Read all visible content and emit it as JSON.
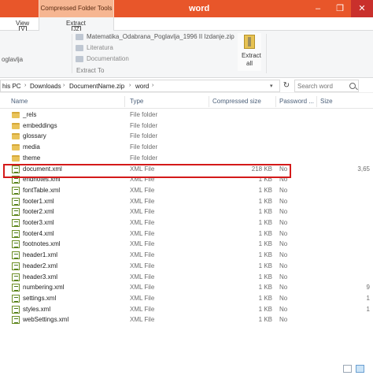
{
  "window": {
    "title": "word",
    "context_tab": "Compressed Folder Tools",
    "minimize": "–",
    "restore": "❐",
    "close": "✕"
  },
  "tabs": {
    "view": "View",
    "view_key": "V",
    "extract": "Extract",
    "extract_key": "JZ"
  },
  "ribbon": {
    "dest_partial": "oglavlja",
    "destinations": [
      "Matematika_Odabrana_Poglavlja_1996 II Izdanje.zip",
      "Literatura",
      "Documentation"
    ],
    "extract_all": "Extract\nall",
    "extract_all_line1": "Extract",
    "extract_all_line2": "all",
    "group_label": "Extract To"
  },
  "address": {
    "crumbs": [
      "his PC",
      "Downloads",
      "DocumentName.zip",
      "word"
    ],
    "search_placeholder": "Search word"
  },
  "columns": {
    "name": "Name",
    "type": "Type",
    "compressed": "Compressed size",
    "password": "Password ...",
    "size": "Size"
  },
  "rows": [
    {
      "name": "_rels",
      "kind": "folder",
      "type": "File folder",
      "compressed": "",
      "password": "",
      "size": ""
    },
    {
      "name": "embeddings",
      "kind": "folder",
      "type": "File folder",
      "compressed": "",
      "password": "",
      "size": ""
    },
    {
      "name": "glossary",
      "kind": "folder",
      "type": "File folder",
      "compressed": "",
      "password": "",
      "size": ""
    },
    {
      "name": "media",
      "kind": "folder",
      "type": "File folder",
      "compressed": "",
      "password": "",
      "size": ""
    },
    {
      "name": "theme",
      "kind": "folder",
      "type": "File folder",
      "compressed": "",
      "password": "",
      "size": ""
    },
    {
      "name": "document.xml",
      "kind": "xml",
      "type": "XML File",
      "compressed": "218 KB",
      "password": "No",
      "size": "3,65"
    },
    {
      "name": "endnotes.xml",
      "kind": "xml",
      "type": "XML File",
      "compressed": "1 KB",
      "password": "No",
      "size": ""
    },
    {
      "name": "fontTable.xml",
      "kind": "xml",
      "type": "XML File",
      "compressed": "1 KB",
      "password": "No",
      "size": ""
    },
    {
      "name": "footer1.xml",
      "kind": "xml",
      "type": "XML File",
      "compressed": "1 KB",
      "password": "No",
      "size": ""
    },
    {
      "name": "footer2.xml",
      "kind": "xml",
      "type": "XML File",
      "compressed": "1 KB",
      "password": "No",
      "size": ""
    },
    {
      "name": "footer3.xml",
      "kind": "xml",
      "type": "XML File",
      "compressed": "1 KB",
      "password": "No",
      "size": ""
    },
    {
      "name": "footer4.xml",
      "kind": "xml",
      "type": "XML File",
      "compressed": "1 KB",
      "password": "No",
      "size": ""
    },
    {
      "name": "footnotes.xml",
      "kind": "xml",
      "type": "XML File",
      "compressed": "1 KB",
      "password": "No",
      "size": ""
    },
    {
      "name": "header1.xml",
      "kind": "xml",
      "type": "XML File",
      "compressed": "1 KB",
      "password": "No",
      "size": ""
    },
    {
      "name": "header2.xml",
      "kind": "xml",
      "type": "XML File",
      "compressed": "1 KB",
      "password": "No",
      "size": ""
    },
    {
      "name": "header3.xml",
      "kind": "xml",
      "type": "XML File",
      "compressed": "1 KB",
      "password": "No",
      "size": ""
    },
    {
      "name": "numbering.xml",
      "kind": "xml",
      "type": "XML File",
      "compressed": "1 KB",
      "password": "No",
      "size": "9"
    },
    {
      "name": "settings.xml",
      "kind": "xml",
      "type": "XML File",
      "compressed": "1 KB",
      "password": "No",
      "size": "1"
    },
    {
      "name": "styles.xml",
      "kind": "xml",
      "type": "XML File",
      "compressed": "1 KB",
      "password": "No",
      "size": "1"
    },
    {
      "name": "webSettings.xml",
      "kind": "xml",
      "type": "XML File",
      "compressed": "1 KB",
      "password": "No",
      "size": ""
    }
  ],
  "colors": {
    "titlebar": "#e8562a",
    "context_tab": "#f6b692",
    "highlight": "#d41a1a"
  },
  "icons": {
    "folder": "folder-icon",
    "xml": "xml-file-icon",
    "extract": "zip-extract-icon",
    "search": "search-icon",
    "refresh": "refresh-icon"
  }
}
